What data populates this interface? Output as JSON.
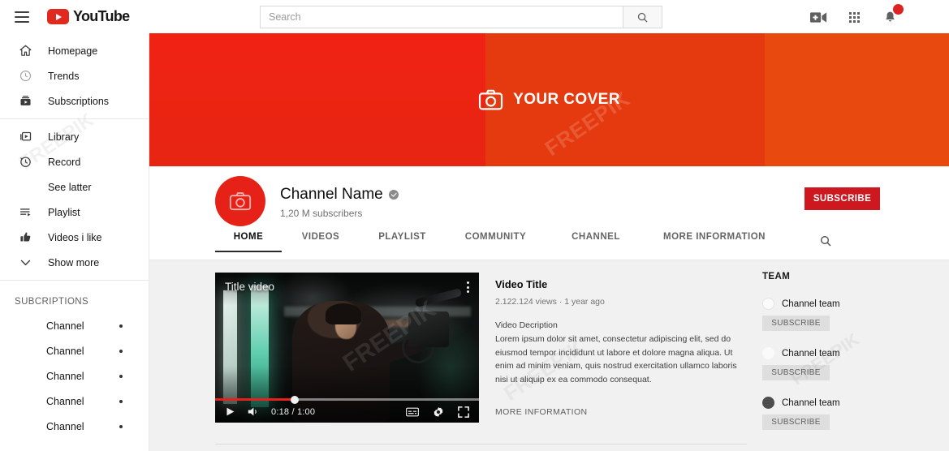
{
  "header": {
    "logo_text": "YouTube",
    "menu_label": "menu",
    "search_placeholder": "Search",
    "search_value": "",
    "search_button_label": "search",
    "create_label": "create-video",
    "apps_label": "apps",
    "notifications_label": "notifications"
  },
  "sidebar": {
    "groups": [
      {
        "items": [
          {
            "label": "Homepage",
            "icon": "home-icon"
          },
          {
            "label": "Trends",
            "icon": "trending-icon"
          },
          {
            "label": "Subscriptions",
            "icon": "subscriptions-icon"
          }
        ]
      },
      {
        "items": [
          {
            "label": "Library",
            "icon": "library-icon"
          },
          {
            "label": "Record",
            "icon": "history-clock-icon"
          },
          {
            "label": "See latter",
            "icon": "none"
          },
          {
            "label": "Playlist",
            "icon": "playlist-icon"
          },
          {
            "label": "Videos i like",
            "icon": "thumbs-up-icon"
          },
          {
            "label": "Show more",
            "icon": "chevron-down-icon"
          }
        ]
      }
    ],
    "subscriptions_title": "SUBCRIPTIONS",
    "subscriptions": [
      {
        "label": "Channel"
      },
      {
        "label": "Channel"
      },
      {
        "label": "Channel"
      },
      {
        "label": "Channel"
      },
      {
        "label": "Channel"
      }
    ]
  },
  "banner": {
    "cover_text": "YOUR COVER",
    "camera_icon": "camera-icon",
    "watermark": "FREEPIK",
    "color_left": "#ee2111",
    "color_mid": "#e43a10",
    "color_right": "#e8490e"
  },
  "channel": {
    "name": "Channel Name",
    "verified": true,
    "subscribers": "1,20 M subscribers",
    "subscribe_label": "SUBSCRIBE",
    "subscribe_color": "#cc181e",
    "avatar_icon": "camera-icon"
  },
  "tabs": [
    {
      "label": "HOME",
      "active": true
    },
    {
      "label": "VIDEOS",
      "active": false
    },
    {
      "label": "PLAYLIST",
      "active": false
    },
    {
      "label": "COMMUNITY",
      "active": false
    },
    {
      "label": "CHANNEL",
      "active": false
    },
    {
      "label": "MORE INFORMATION",
      "active": false
    }
  ],
  "tab_search_icon": "search-icon",
  "player": {
    "overlay_title": "Title video",
    "kebab_icon": "more-vertical-icon",
    "play_icon": "play-icon",
    "volume_icon": "volume-icon",
    "time": "0:18 / 1:00",
    "current_time": "0:18",
    "duration": "1:00",
    "progress_percent": 30,
    "captions_icon": "captions-icon",
    "settings_icon": "gear-icon",
    "fullscreen_icon": "fullscreen-icon",
    "watermark": "FREEPIK"
  },
  "video": {
    "title": "Video Title",
    "views": "2.122.124 views",
    "separator": "·",
    "age": "1 year ago",
    "description_heading": "Video Decription",
    "description": "Lorem ipsum dolor sit amet, consectetur adipiscing elit, sed do eiusmod tempor incididunt ut labore et dolore magna aliqua. Ut enim ad minim veniam, quis nostrud exercitation ullamco laboris nisi ut aliquip ex ea commodo consequat.",
    "more_information": "MORE INFORMATION"
  },
  "team": {
    "title": "TEAM",
    "members": [
      {
        "name": "Channel team",
        "subscribe_label": "SUBSCRIBE"
      },
      {
        "name": "Channel team",
        "subscribe_label": "SUBSCRIBE"
      },
      {
        "name": "Channel team",
        "subscribe_label": "SUBSCRIBE"
      }
    ]
  },
  "watermarks": {
    "text": "FREEPIK"
  }
}
